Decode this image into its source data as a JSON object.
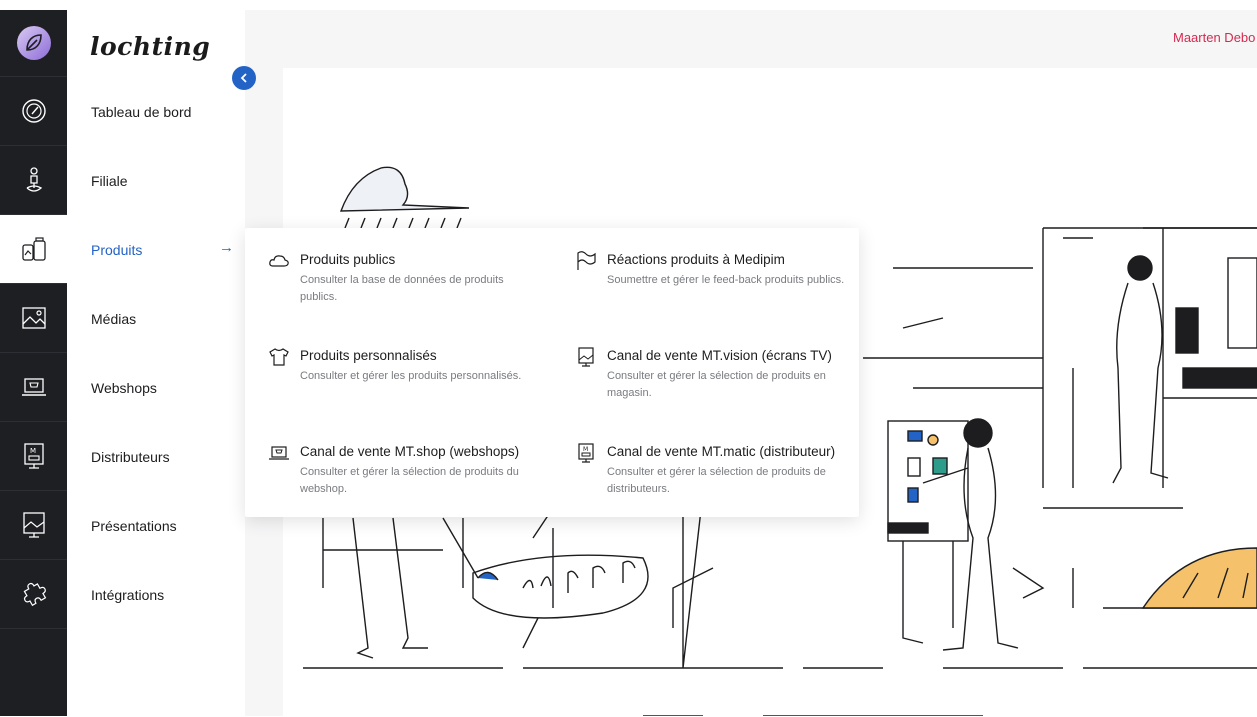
{
  "brand": "lochting",
  "user": {
    "name": "Maarten Debo"
  },
  "rail": {
    "icons": [
      "dashboard-icon",
      "store-icon",
      "products-icon",
      "media-icon",
      "webshop-icon",
      "distributor-icon",
      "presentation-icon",
      "integrations-icon"
    ]
  },
  "nav": {
    "items": [
      {
        "label": "Tableau de bord"
      },
      {
        "label": "Filiale"
      },
      {
        "label": "Produits"
      },
      {
        "label": "Médias"
      },
      {
        "label": "Webshops"
      },
      {
        "label": "Distributeurs"
      },
      {
        "label": "Présentations"
      },
      {
        "label": "Intégrations"
      }
    ],
    "active": "Produits",
    "arrow": "→"
  },
  "menu": {
    "items": [
      {
        "title": "Produits publics",
        "desc": "Consulter la base de données de produits publics.",
        "icon": "cloud-icon"
      },
      {
        "title": "Réactions produits à Medipim",
        "desc": "Soumettre et gérer le feed-back produits publics.",
        "icon": "flag-icon"
      },
      {
        "title": "Produits personnalisés",
        "desc": "Consulter et gérer les produits personnalisés.",
        "icon": "tshirt-icon"
      },
      {
        "title": "Canal de vente MT.vision (écrans TV)",
        "desc": "Consulter et gérer la sélection de produits en magasin.",
        "icon": "tv-screen-icon"
      },
      {
        "title": "Canal de vente MT.shop (webshops)",
        "desc": "Consulter et gérer la sélection de produits du webshop.",
        "icon": "laptop-cart-icon"
      },
      {
        "title": "Canal de vente MT.matic (distributeur)",
        "desc": "Consulter et gérer la sélection de produits de distributeurs.",
        "icon": "vending-machine-icon"
      }
    ]
  },
  "colors": {
    "accent": "#2463c6",
    "user": "#d6294f",
    "rail": "#1e1f23"
  }
}
